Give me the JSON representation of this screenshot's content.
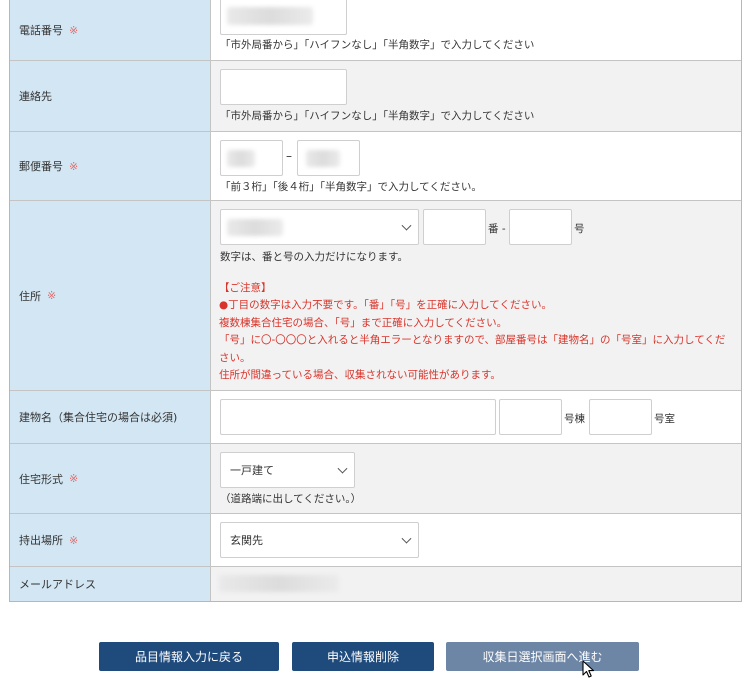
{
  "rows": {
    "phone": {
      "label": "電話番号",
      "required_mark": "※",
      "hint": "「市外局番から」「ハイフンなし」「半角数字」で入力してください"
    },
    "contact": {
      "label": "連絡先",
      "hint": "「市外局番から」「ハイフンなし」「半角数字」で入力してください"
    },
    "postal": {
      "label": "郵便番号",
      "required_mark": "※",
      "separator": "–",
      "hint": "「前３桁」「後４桁」「半角数字」で入力してください。"
    },
    "address": {
      "label": "住所",
      "required_mark": "※",
      "ban_suffix": "番 -",
      "go_suffix": "号",
      "digits_note": "数字は、番と号の入力だけになります。",
      "notice_lines": [
        "【ご注意】",
        "●丁目の数字は入力不要です。「番」「号」を正確に入力してください。",
        "複数棟集合住宅の場合、「号」まで正確に入力してください。",
        "「号」に〇-〇〇〇と入れると半角エラーとなりますので、部屋番号は「建物名」の「号室」に入力してください。",
        "住所が間違っている場合、収集されない可能性があります。"
      ]
    },
    "building": {
      "label": "建物名（集合住宅の場合は必須)",
      "building_suffix": "号棟",
      "room_suffix": "号室"
    },
    "housing": {
      "label": "住宅形式",
      "required_mark": "※",
      "selected": "一戸建て",
      "note": "（道路端に出してください。）"
    },
    "pickup": {
      "label": "持出場所",
      "required_mark": "※",
      "selected": "玄関先"
    },
    "email": {
      "label": "メールアドレス"
    }
  },
  "buttons": {
    "back": "品目情報入力に戻る",
    "delete": "申込情報削除",
    "next": "収集日選択画面へ進む"
  },
  "colors": {
    "label_bg": "#d3e6f3",
    "button_primary": "#1f4a7c",
    "button_next": "#6d86a6",
    "required": "#e06f6f",
    "notice": "#d9342b"
  },
  "icons": {
    "select_arrow": "chevron-down-icon",
    "cursor": "mouse-pointer-icon"
  }
}
